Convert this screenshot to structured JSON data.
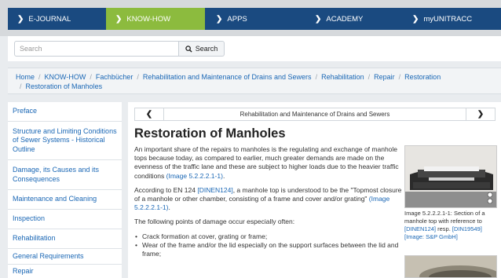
{
  "nav": {
    "items": [
      {
        "label": "E-JOURNAL"
      },
      {
        "label": "KNOW-HOW"
      },
      {
        "label": "APPS"
      },
      {
        "label": "ACADEMY"
      },
      {
        "label": "myUNITRACC"
      }
    ],
    "active_color": "#8cbb3e",
    "bar_color": "#1a4a80"
  },
  "search": {
    "placeholder": "Search",
    "button_label": "Search"
  },
  "breadcrumb": [
    "Home",
    "KNOW-HOW",
    "Fachbücher",
    "Rehabilitation and Maintenance of Drains and Sewers",
    "Rehabilitation",
    "Repair",
    "Restoration",
    "Restoration of Manholes"
  ],
  "sidebar": {
    "items": [
      {
        "label": "Preface"
      },
      {
        "label": "Structure and Limiting Conditions of Sewer Systems - Historical Outline"
      },
      {
        "label": "Damage, its Causes and its Consequences"
      },
      {
        "label": "Maintenance and Cleaning"
      },
      {
        "label": "Inspection"
      },
      {
        "label": "Rehabilitation"
      },
      {
        "label": "General Requirements"
      },
      {
        "label": "Repair"
      }
    ]
  },
  "pager": {
    "title": "Rehabilitation and Maintenance of Drains and Sewers"
  },
  "article": {
    "title": "Restoration of Manholes",
    "p1": "An important share of the repairs to manholes is the regulating and exchange of manhole tops because today, as compared to earlier, much greater demands are made on the evenness of the traffic lane and these are subject to higher loads due to the heavier traffic conditions ",
    "p1_link": "(Image 5.2.2.2.1-1)",
    "p1_end": ".",
    "p2_a": "According to EN 124 ",
    "p2_link1": "[DINEN124]",
    "p2_b": ", a manhole top is understood to be the \"Topmost closure of a manhole or other chamber, consisting of a frame and cover and/or grating\" ",
    "p2_link2": "(Image 5.2.2.2.1-1)",
    "p2_end": ".",
    "p3": "The following points of damage occur especially often:",
    "bullets": [
      "Crack formation at cover, grating or frame;",
      "Wear of the frame and/or the lid especially on the support surfaces between the lid and frame;"
    ]
  },
  "figure": {
    "caption_text": "Image 5.2.2.2.1-1: Section of a manhole top with reference to ",
    "caption_link1": "[DINEN124]",
    "caption_mid": " resp. ",
    "caption_link2": "[DIN19549]",
    "caption_link3": "[Image: S&P GmbH]"
  }
}
